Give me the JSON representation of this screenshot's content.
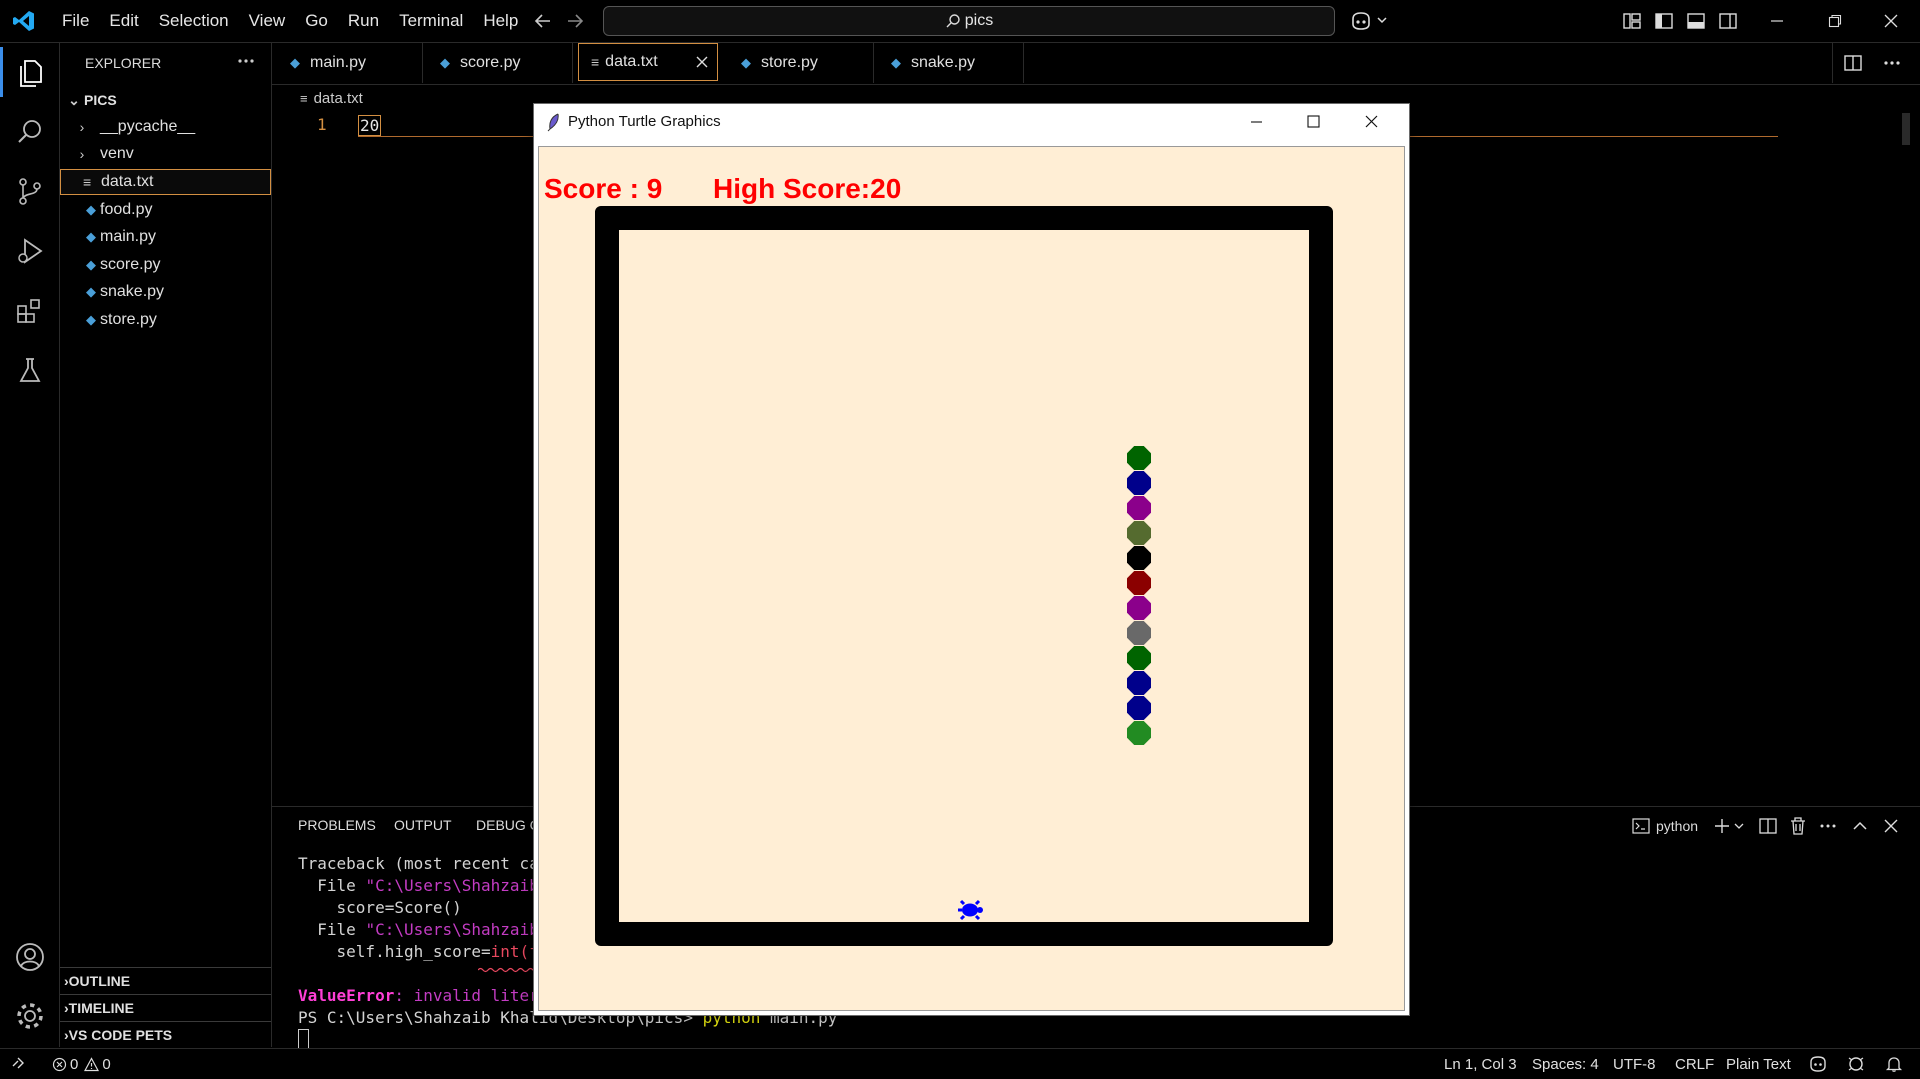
{
  "titlebar": {
    "menu": [
      "File",
      "Edit",
      "Selection",
      "View",
      "Go",
      "Run",
      "Terminal",
      "Help"
    ],
    "search_text": "pics"
  },
  "sidebar": {
    "title": "EXPLORER",
    "folder": "PICS",
    "items": [
      {
        "label": "__pycache__",
        "type": "folder"
      },
      {
        "label": "venv",
        "type": "folder"
      },
      {
        "label": "data.txt",
        "type": "text",
        "selected": true
      },
      {
        "label": "food.py",
        "type": "python"
      },
      {
        "label": "main.py",
        "type": "python"
      },
      {
        "label": "score.py",
        "type": "python"
      },
      {
        "label": "snake.py",
        "type": "python"
      },
      {
        "label": "store.py",
        "type": "python"
      }
    ],
    "sections": [
      "OUTLINE",
      "TIMELINE",
      "VS CODE PETS"
    ]
  },
  "tabs": [
    {
      "label": "main.py"
    },
    {
      "label": "score.py"
    },
    {
      "label": "data.txt",
      "active": true
    },
    {
      "label": "store.py"
    },
    {
      "label": "snake.py"
    }
  ],
  "editor": {
    "breadcrumb": "data.txt",
    "line_number": "1",
    "line_text": "20"
  },
  "panel": {
    "tabs": [
      "PROBLEMS",
      "OUTPUT",
      "DEBUG C"
    ],
    "terminal_name": "python",
    "lines": [
      {
        "text": "Traceback (most recent cal",
        "color": "#d4d4d4"
      },
      {
        "prefix": "  File ",
        "text": "\"C:\\Users\\Shahzaib",
        "color": "#c33cc3"
      },
      {
        "text": "    score=Score()",
        "color": "#d4d4d4"
      },
      {
        "prefix": "  File ",
        "text": "\"C:\\Users\\Shahzaib",
        "color": "#c33cc3"
      },
      {
        "prefix": "    self.high_score=",
        "text": "int(fi",
        "color": "#e8485f"
      }
    ],
    "error_name": "ValueError",
    "error_text": ": invalid litera",
    "prompt_text": "PS C:\\Users\\Shahzaib Khalid\\Desktop\\pics> ",
    "command_name": "python",
    "command_arg": " main.py"
  },
  "statusbar": {
    "errors": "0",
    "warnings": "0",
    "position": "Ln 1, Col 3",
    "spaces": "Spaces: 4",
    "encoding": "UTF-8",
    "eol": "CRLF",
    "language": "Plain Text"
  },
  "turtle": {
    "title": "Python Turtle Graphics",
    "score_text": "Score : 9",
    "high_score_text": "High Score:20",
    "snake_colors": [
      "#006400",
      "#00008b",
      "#8b008b",
      "#556b2f",
      "#000000",
      "#8b0000",
      "#8b008b",
      "#696969",
      "#006400",
      "#00008b",
      "#00008b",
      "#228b22"
    ],
    "food_color": "#0000ff",
    "background": "#ffeed5",
    "score_color": "#ff0000"
  },
  "colors": {
    "accent": "#3b8eea",
    "active_tab_border": "#d38f42",
    "python_icon": "#4a9fd8"
  }
}
